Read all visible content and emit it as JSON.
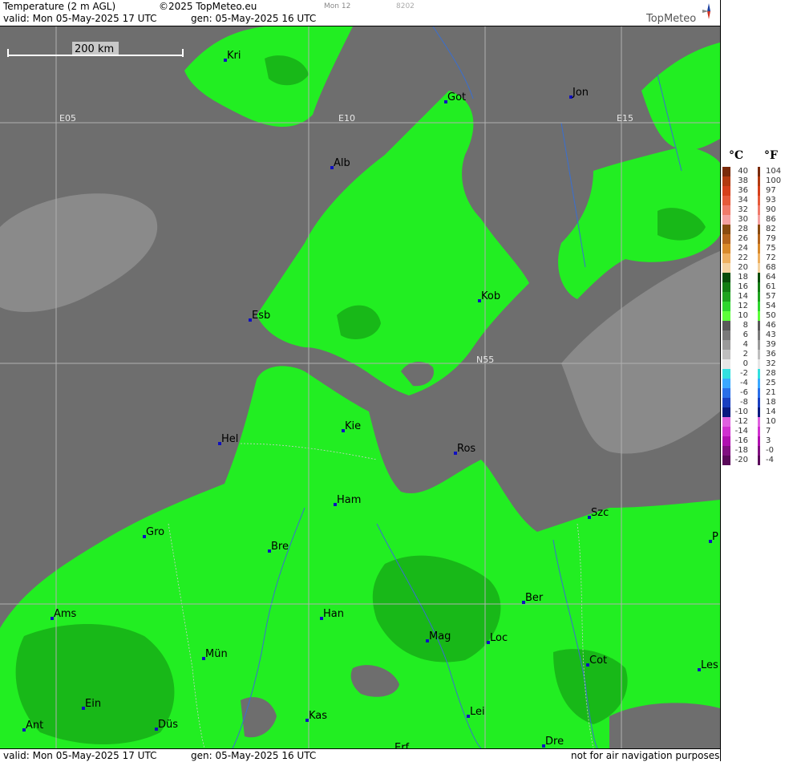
{
  "header": {
    "title": "Temperature (2 m AGL)",
    "copyright": "©2025 TopMeteo.eu",
    "model": "Mon 12",
    "code": "8202",
    "valid": "valid:  Mon  05-May-2025  17 UTC",
    "gen": "gen: 05-May-2025 16 UTC",
    "logo": "TopMeteo"
  },
  "footer": {
    "valid": "valid:  Mon  05-May-2025  17 UTC",
    "gen": "gen: 05-May-2025 16 UTC",
    "notice": "not for air navigation purposes"
  },
  "scale_bar": "200 km",
  "grid_labels": [
    "E05",
    "E10",
    "E15",
    "N55"
  ],
  "cities": [
    {
      "name": "Kri"
    },
    {
      "name": "Got"
    },
    {
      "name": "Jon"
    },
    {
      "name": "Alb"
    },
    {
      "name": "Esb"
    },
    {
      "name": "Kob"
    },
    {
      "name": "Kie"
    },
    {
      "name": "Hel"
    },
    {
      "name": "Ros"
    },
    {
      "name": "Ham"
    },
    {
      "name": "Szc"
    },
    {
      "name": "Gro"
    },
    {
      "name": "Bre"
    },
    {
      "name": "P"
    },
    {
      "name": "Ber"
    },
    {
      "name": "Ams"
    },
    {
      "name": "Han"
    },
    {
      "name": "Mag"
    },
    {
      "name": "Loc"
    },
    {
      "name": "Mün"
    },
    {
      "name": "Cot"
    },
    {
      "name": "Les"
    },
    {
      "name": "Ein"
    },
    {
      "name": "Kas"
    },
    {
      "name": "Lei"
    },
    {
      "name": "Ant"
    },
    {
      "name": "Düs"
    },
    {
      "name": "Dre"
    },
    {
      "name": "Erf"
    }
  ],
  "legend": {
    "unit_c": "°C",
    "unit_f": "°F",
    "celsius": [
      "40",
      "38",
      "36",
      "34",
      "32",
      "30",
      "28",
      "26",
      "24",
      "22",
      "20",
      "18",
      "16",
      "14",
      "12",
      "10",
      "8",
      "6",
      "4",
      "2",
      "0",
      "-2",
      "-4",
      "-6",
      "-8",
      "-10",
      "-12",
      "-14",
      "-16",
      "-18",
      "-20"
    ],
    "fahrenheit": [
      "104",
      "100",
      "97",
      "93",
      "90",
      "86",
      "82",
      "79",
      "75",
      "72",
      "68",
      "64",
      "61",
      "57",
      "54",
      "50",
      "46",
      "43",
      "39",
      "36",
      "32",
      "28",
      "25",
      "21",
      "18",
      "14",
      "10",
      "7",
      "3",
      "-0",
      "-4"
    ],
    "colors": [
      "#7a2a0a",
      "#b33a10",
      "#d6401b",
      "#e65a3a",
      "#f07a6a",
      "#f4a0a0",
      "#8a4b10",
      "#b5651d",
      "#d98a2b",
      "#eeb060",
      "#f4d2a0",
      "#0a4d0a",
      "#147d14",
      "#1fa31f",
      "#2ed62e",
      "#5cff3a",
      "#5a5a5a",
      "#7a7a7a",
      "#9a9a9a",
      "#bebebe",
      "#e6e6e6",
      "#33e0e0",
      "#3aa8ff",
      "#2a6fe8",
      "#1a3fc0",
      "#0a1a80",
      "#e060e0",
      "#d030d0",
      "#b010b0",
      "#801080",
      "#5a0a5a"
    ]
  },
  "colors": {
    "sea": "#6e6e6e",
    "land_grey": "#5f5f5f",
    "warm_green": "#22ee22",
    "dark_green": "#18b818",
    "cool_grey": "#8a8a8a"
  }
}
